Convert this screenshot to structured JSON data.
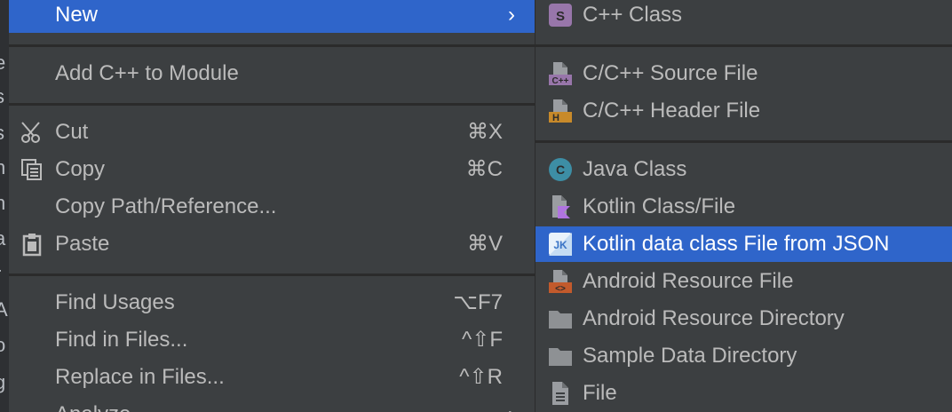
{
  "ide_glyphs": [
    "t",
    "e",
    "s",
    "s",
    "h",
    "h",
    "a",
    "r",
    "A",
    "o",
    "g"
  ],
  "context_menu": {
    "new_label": "New",
    "new_arrow": "›",
    "add_cpp_label": "Add C++ to Module",
    "cut_label": "Cut",
    "cut_shortcut": "⌘X",
    "copy_label": "Copy",
    "copy_shortcut": "⌘C",
    "copy_path_label": "Copy Path/Reference...",
    "paste_label": "Paste",
    "paste_shortcut": "⌘V",
    "find_usages_label": "Find Usages",
    "find_usages_shortcut": "⌥F7",
    "find_in_files_label": "Find in Files...",
    "find_in_files_shortcut": "^⇧F",
    "replace_in_files_label": "Replace in Files...",
    "replace_in_files_shortcut": "^⇧R",
    "analyze_label": "Analyze",
    "analyze_arrow": "›"
  },
  "new_submenu": {
    "cpp_class": {
      "label": "C++ Class",
      "badge": "S"
    },
    "cpp_source": {
      "label": "C/C++ Source File",
      "badge": "C++"
    },
    "cpp_header": {
      "label": "C/C++ Header File",
      "badge": "H"
    },
    "java_class": {
      "label": "Java Class",
      "badge": "C"
    },
    "kotlin_class": {
      "label": "Kotlin Class/File"
    },
    "kotlin_json": {
      "label": "Kotlin data class File from JSON",
      "badge": "JK"
    },
    "android_resource_file": {
      "label": "Android Resource File",
      "badge": "<>"
    },
    "android_resource_dir": {
      "label": "Android Resource Directory"
    },
    "sample_data_dir": {
      "label": "Sample Data Directory"
    },
    "file": {
      "label": "File"
    }
  },
  "colors": {
    "menu_bg": "#3c3f41",
    "selection": "#2f65ca",
    "separator": "#2b2b2b",
    "text": "#bbbbbb",
    "text_selected": "#ffffff"
  }
}
